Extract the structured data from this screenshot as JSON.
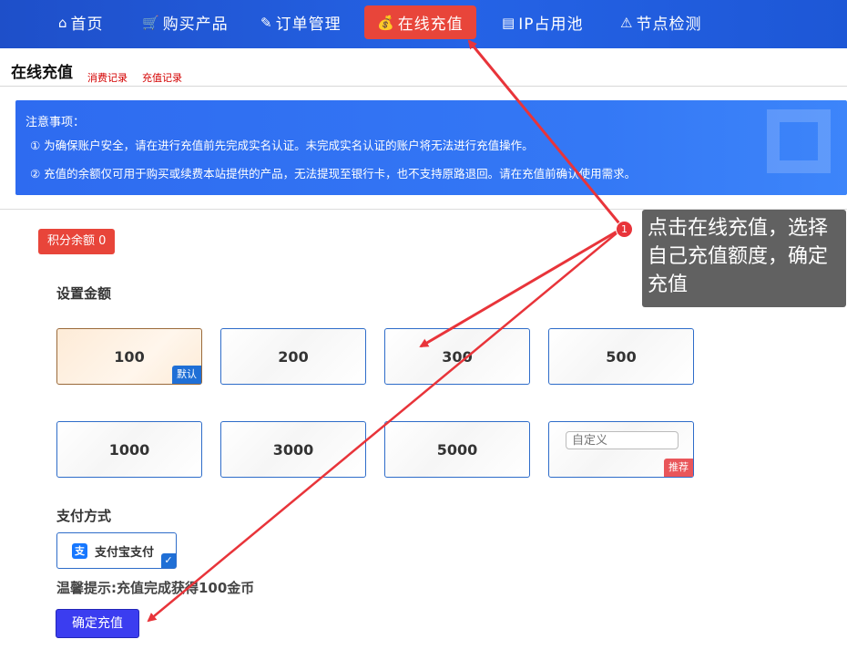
{
  "nav": [
    {
      "icon": "⌂",
      "icon_name": "home-icon",
      "label": "首页"
    },
    {
      "icon": "🛒",
      "icon_name": "cart-icon",
      "label": "购买产品"
    },
    {
      "icon": "✎",
      "icon_name": "order-edit-icon",
      "label": "订单管理"
    },
    {
      "icon": "💰",
      "icon_name": "recharge-icon",
      "label": "在线充值"
    },
    {
      "icon": "▤",
      "icon_name": "ip-pool-icon",
      "label": "IP占用池"
    },
    {
      "icon": "⚠",
      "icon_name": "warning-icon",
      "label": "节点检测"
    }
  ],
  "section": {
    "title": "在线充值",
    "link_consume": "消费记录",
    "link_recharge": "充值记录"
  },
  "notice": {
    "title": "注意事项：",
    "line1": "① 为确保账户安全，请在进行充值前先完成实名认证。未完成实名认证的账户将无法进行充值操作。",
    "line2": "② 充值的余额仅可用于购买或续费本站提供的产品，无法提现至银行卡，也不支持原路退回。请在充值前确认使用需求。"
  },
  "balance_badge": "积分余额 0",
  "amount_label": "设置金额",
  "amounts": [
    "100",
    "200",
    "300",
    "500",
    "1000",
    "3000",
    "5000"
  ],
  "default_tag": "默认",
  "custom_placeholder": "自定义",
  "recommend_tag": "推荐",
  "payment_label": "支付方式",
  "payment_method": "支付宝支付",
  "payment_icon": "支",
  "tip": "温馨提示:充值完成获得100金币",
  "confirm_button": "确定充值",
  "annotation": {
    "number": "1",
    "text": "点击在线充值，选择自己充值额度，确定充值"
  },
  "colors": {
    "nav_bg": "#2563e6",
    "active_tab": "#e8453a",
    "notice_bg": "#3478f5",
    "confirm_bg": "#3b3df0",
    "arrow": "#e8343a"
  }
}
